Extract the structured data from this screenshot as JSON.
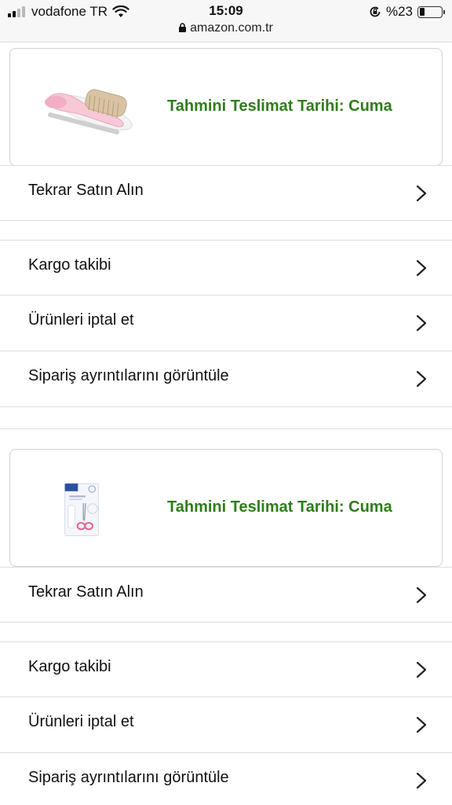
{
  "status_bar": {
    "carrier": "vodafone TR",
    "time": "15:09",
    "battery": "%23",
    "battery_level": 0.23,
    "url": "amazon.com.tr"
  },
  "orders": [
    {
      "product_image": "baby-hair-brush-and-comb-pink",
      "delivery": "Tahmini Teslimat Tarihi: Cuma",
      "buy_again": "Tekrar Satın Alın",
      "actions": [
        "Kargo takibi",
        "Ürünleri iptal et",
        "Sipariş ayrıntılarını görüntüle"
      ]
    },
    {
      "product_image": "chicco-baby-nail-scissors-pink",
      "delivery": "Tahmini Teslimat Tarihi: Cuma",
      "buy_again": "Tekrar Satın Alın",
      "actions": [
        "Kargo takibi",
        "Ürünleri iptal et",
        "Sipariş ayrıntılarını görüntüle"
      ]
    }
  ],
  "icons": {
    "row_arrow": "chevron-right-icon"
  },
  "colors": {
    "delivery_green": "#2f7d1a",
    "divider": "#dedede"
  }
}
